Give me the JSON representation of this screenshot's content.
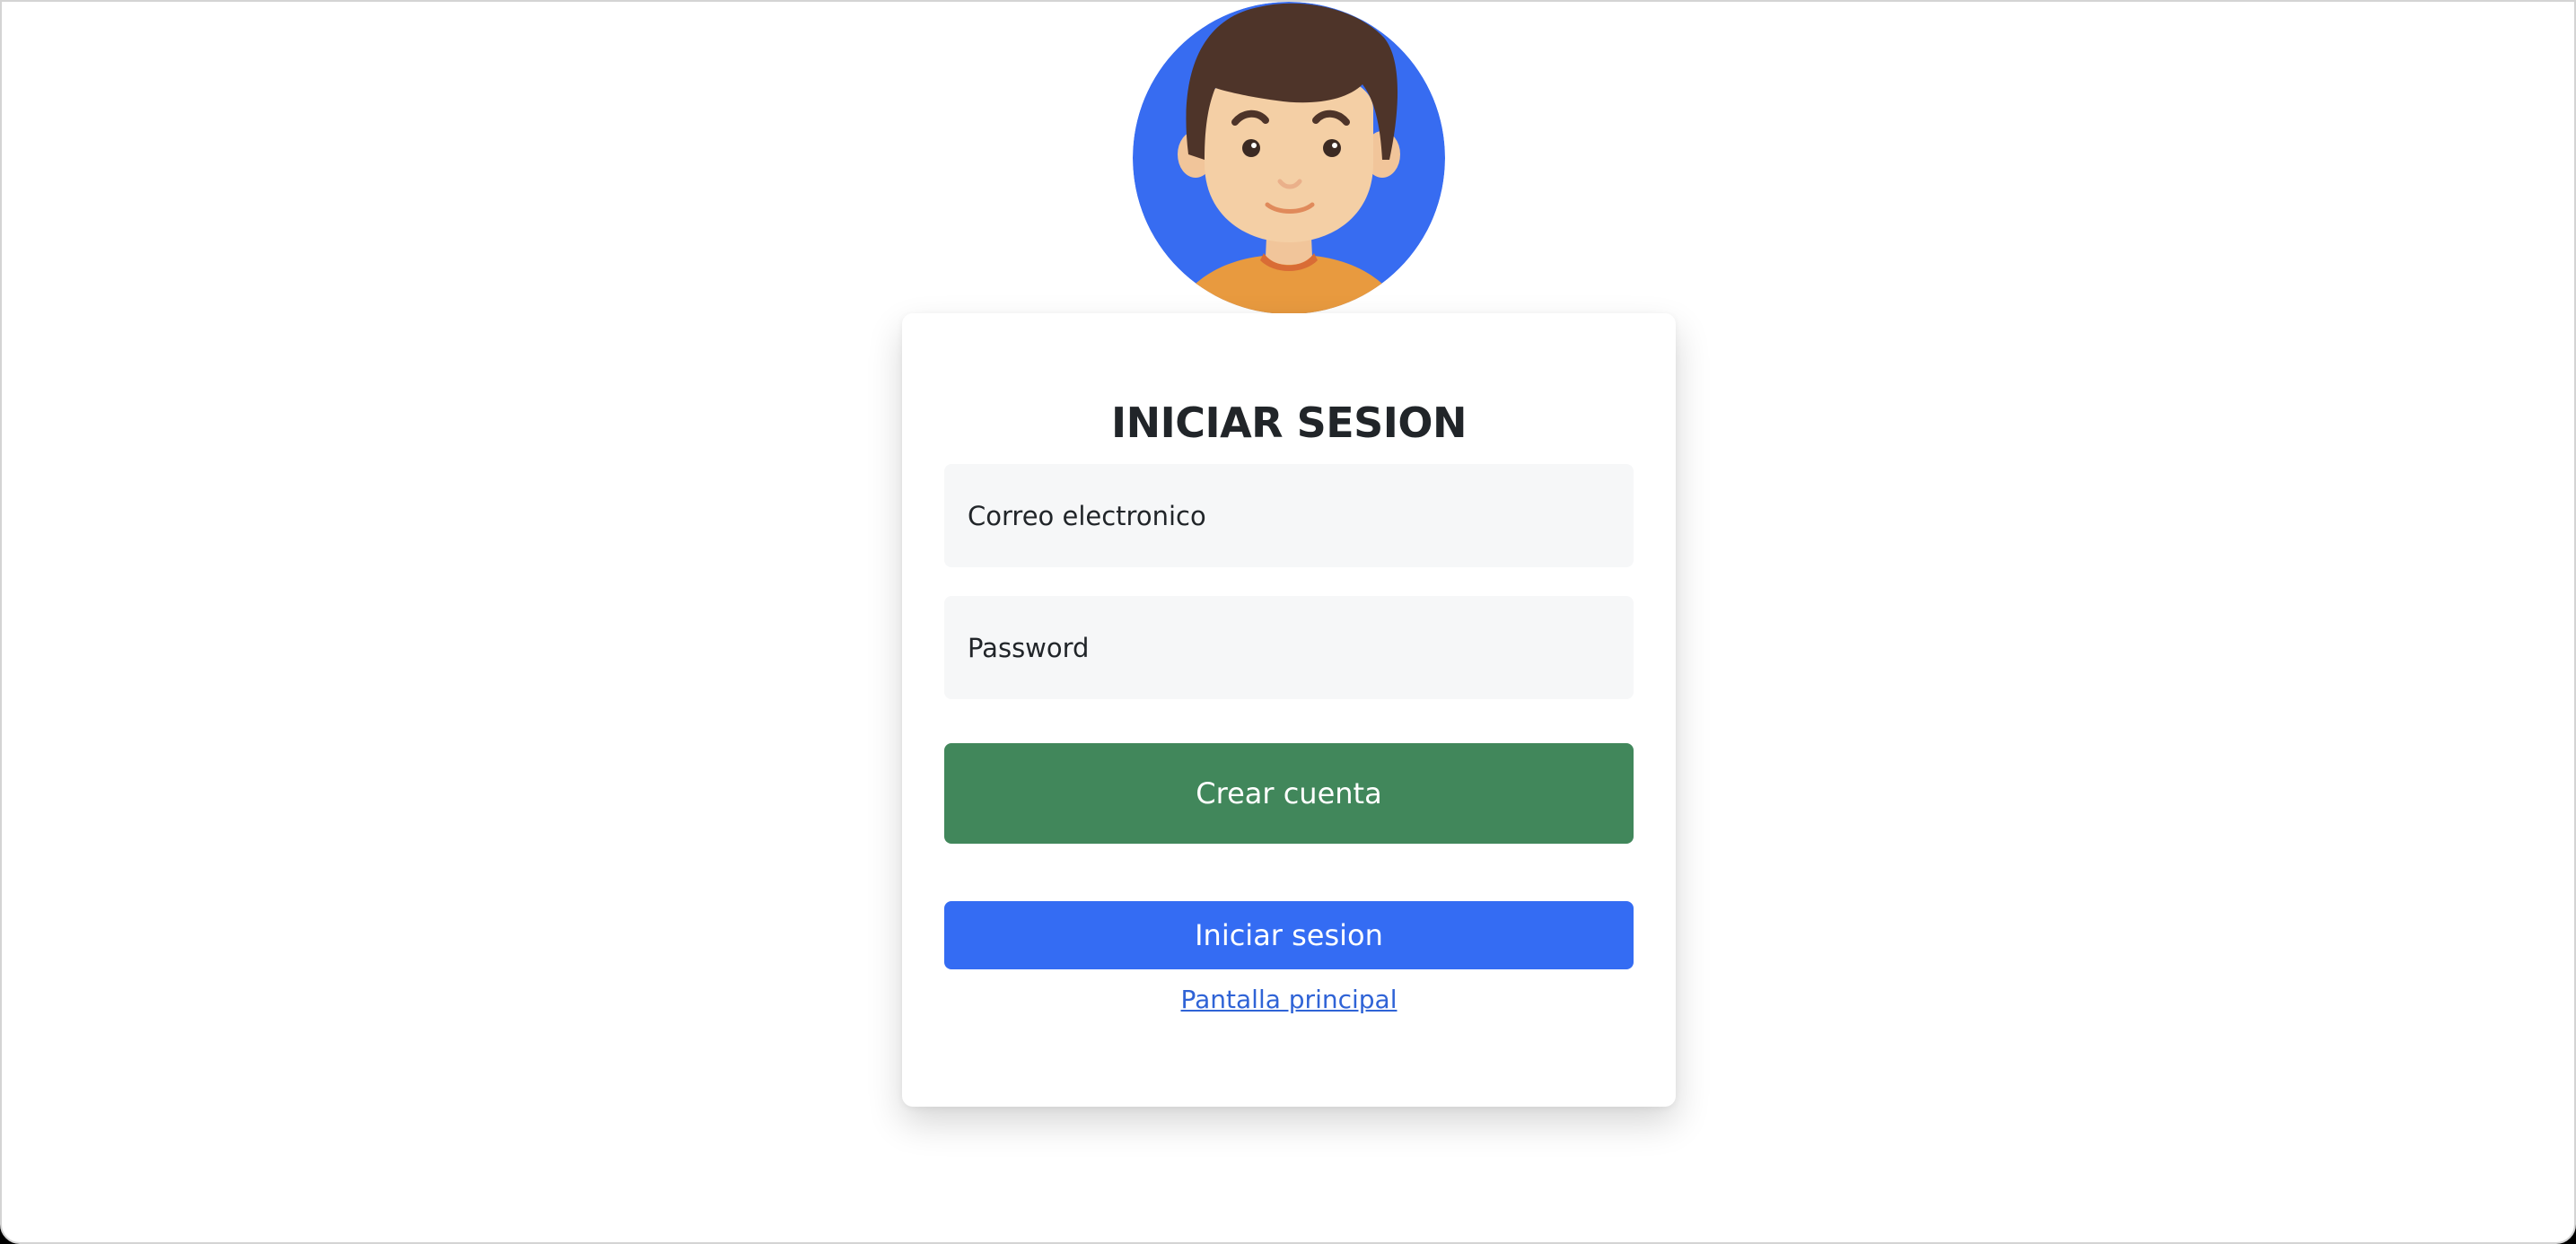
{
  "login": {
    "title": "INICIAR SESION",
    "email_placeholder": "Correo electronico",
    "password_placeholder": "Password",
    "create_account_label": "Crear cuenta",
    "login_label": "Iniciar sesion",
    "home_link_label": "Pantalla principal"
  },
  "avatar": {
    "icon": "user-avatar-boy",
    "background_color": "#376cf1",
    "hair_color": "#4e3429",
    "skin_color": "#f4cfa5",
    "shirt_color": "#e89a3f"
  },
  "colors": {
    "create_button": "#41875b",
    "login_button": "#346cf3",
    "link": "#2f63d6",
    "input_background": "#f6f7f8"
  }
}
